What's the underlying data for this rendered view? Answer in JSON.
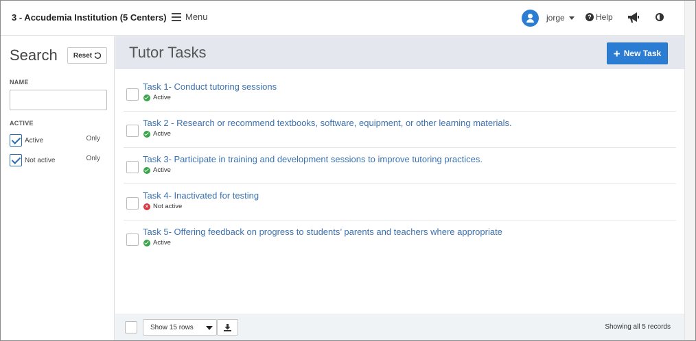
{
  "header": {
    "institution": "3 - Accudemia Institution (5 Centers)",
    "menu_label": "Menu",
    "user_name": "jorge",
    "help_label": "Help"
  },
  "icons": {
    "menu": "hamburger-icon",
    "avatar": "user-icon",
    "user_dropdown": "caret-down-icon",
    "help": "question-circle-icon",
    "announcements": "megaphone-icon",
    "contrast": "contrast-icon",
    "reset": "undo-icon",
    "new_task": "plus-icon",
    "status_active": "check-circle-icon",
    "status_inactive": "x-circle-icon",
    "rows_dropdown": "caret-down-icon",
    "download": "download-icon"
  },
  "colors": {
    "accent": "#2b7cd3",
    "link": "#3b72b0",
    "header_band": "#e4e8ee",
    "status_active": "#3aa64a",
    "status_inactive": "#d9363e"
  },
  "sidebar": {
    "title": "Search",
    "reset_label": "Reset",
    "name_label": "NAME",
    "name_value": "",
    "active_label": "ACTIVE",
    "filters": [
      {
        "label": "Active",
        "checked": true,
        "only_label": "Only"
      },
      {
        "label": "Not active",
        "checked": true,
        "only_label": "Only"
      }
    ]
  },
  "main": {
    "title": "Tutor Tasks",
    "new_task_label": "New Task",
    "tasks": [
      {
        "title": "Task 1- Conduct tutoring sessions",
        "status": "Active",
        "active": true
      },
      {
        "title": "Task 2 - Research or recommend textbooks, software, equipment, or other learning materials.",
        "status": "Active",
        "active": true
      },
      {
        "title": "Task 3- Participate in training and development sessions to improve tutoring practices.",
        "status": "Active",
        "active": true
      },
      {
        "title": "Task 4- Inactivated for testing",
        "status": "Not active",
        "active": false
      },
      {
        "title": "Task 5- Offering feedback on progress to students’ parents and teachers where appropriate",
        "status": "Active",
        "active": true
      }
    ]
  },
  "footer": {
    "rows_select": "Show 15 rows",
    "showing": "Showing all 5 records"
  }
}
